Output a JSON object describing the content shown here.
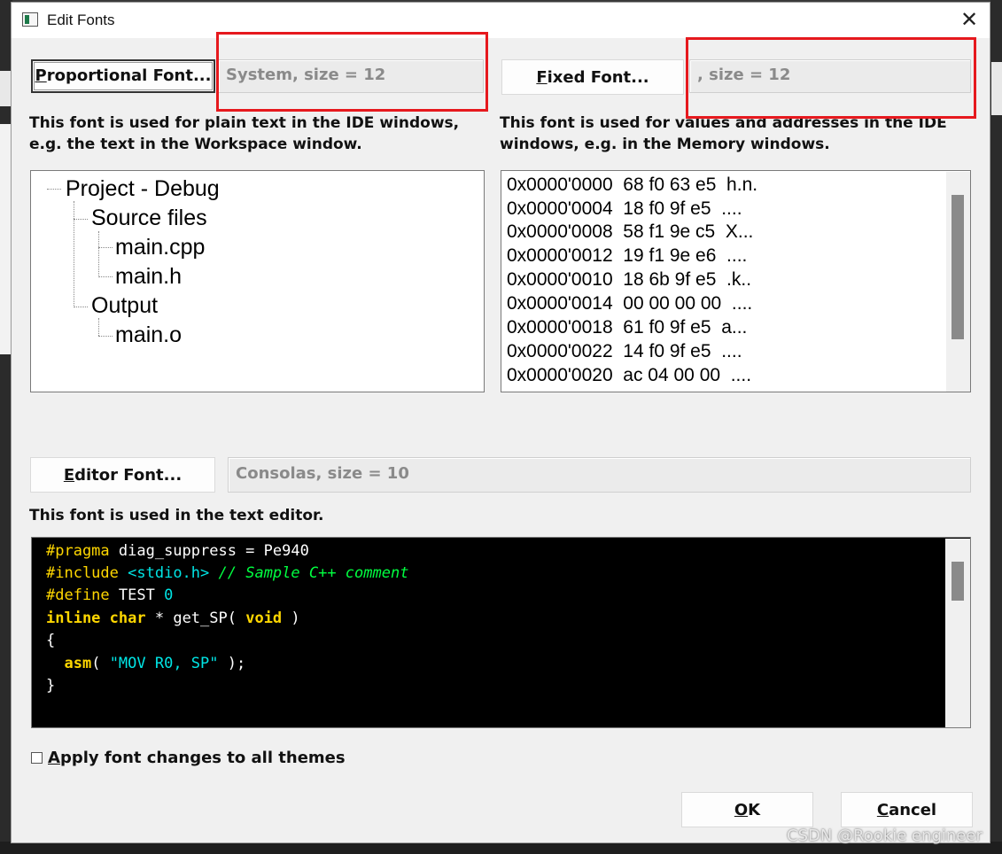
{
  "window": {
    "title": "Edit Fonts",
    "close_glyph": "✕"
  },
  "proportional": {
    "button_label": "Proportional Font...",
    "underline_char": "P",
    "button_rest": "roportional Font...",
    "value": "System, size = 12",
    "description_lines": [
      "This font is used for plain text in the IDE windows,",
      "e.g. the text in the Workspace window."
    ],
    "tree": [
      {
        "label": "Project - Debug",
        "depth": 0
      },
      {
        "label": "Source files",
        "depth": 1
      },
      {
        "label": "main.cpp",
        "depth": 2
      },
      {
        "label": "main.h",
        "depth": 2
      },
      {
        "label": "Output",
        "depth": 1
      },
      {
        "label": "main.o",
        "depth": 2
      }
    ]
  },
  "fixed": {
    "button_label": "Fixed Font...",
    "underline_char": "F",
    "button_rest": "ixed Font...",
    "value": ", size = 12",
    "description_lines": [
      "This font is used for values and addresses in the IDE",
      "windows, e.g. in the Memory windows."
    ],
    "memory_lines": [
      "0x0000'0000  68 f0 63 e5  h.n.",
      "0x0000'0004  18 f0 9f e5  ....",
      "0x0000'0008  58 f1 9e c5  X...",
      "0x0000'0012  19 f1 9e e6  ....",
      "0x0000'0010  18 6b 9f e5  .k..",
      "0x0000'0014  00 00 00 00  ....",
      "0x0000'0018  61 f0 9f e5  a...",
      "0x0000'0022  14 f0 9f e5  ....",
      "0x0000'0020  ac 04 00 00  ...."
    ]
  },
  "editor": {
    "button_label": "Editor Font...",
    "underline_char": "E",
    "button_rest": "ditor Font...",
    "value": "Consolas, size = 10",
    "description": "This font is used in the text editor.",
    "code": {
      "l1_pre": "#pragma",
      "l1_rest": " diag_suppress = Pe940",
      "l2_pre": "#include",
      "l2_sp": " ",
      "l2_str": "<stdio.h>",
      "l2_sp2": " ",
      "l2_cmt": "// Sample C++ comment",
      "l3_pre": "#define",
      "l3_rest": " TEST ",
      "l3_num": "0",
      "l4_kw1": "inline",
      "l4_sp": " ",
      "l4_kw2": "char",
      "l4_mid": " * get_SP( ",
      "l4_kw3": "void",
      "l4_end": " )",
      "l5": "{",
      "l6_indent": "  ",
      "l6_kw": "asm",
      "l6_mid": "( ",
      "l6_str": "\"MOV R0, SP\"",
      "l6_end": " );",
      "l7": "}"
    }
  },
  "apply_all": {
    "label": "Apply font changes to all themes",
    "underline_char": "A",
    "rest": "pply font changes to all themes",
    "checked": false
  },
  "buttons": {
    "ok": "OK",
    "ok_u": "O",
    "ok_rest": "K",
    "cancel": "Cancel",
    "cancel_u": "C",
    "cancel_rest": "ancel"
  },
  "watermark": "CSDN @Rookie engineer",
  "colors": {
    "highlight_box": "#e6191e",
    "editor_bg": "#000000"
  }
}
